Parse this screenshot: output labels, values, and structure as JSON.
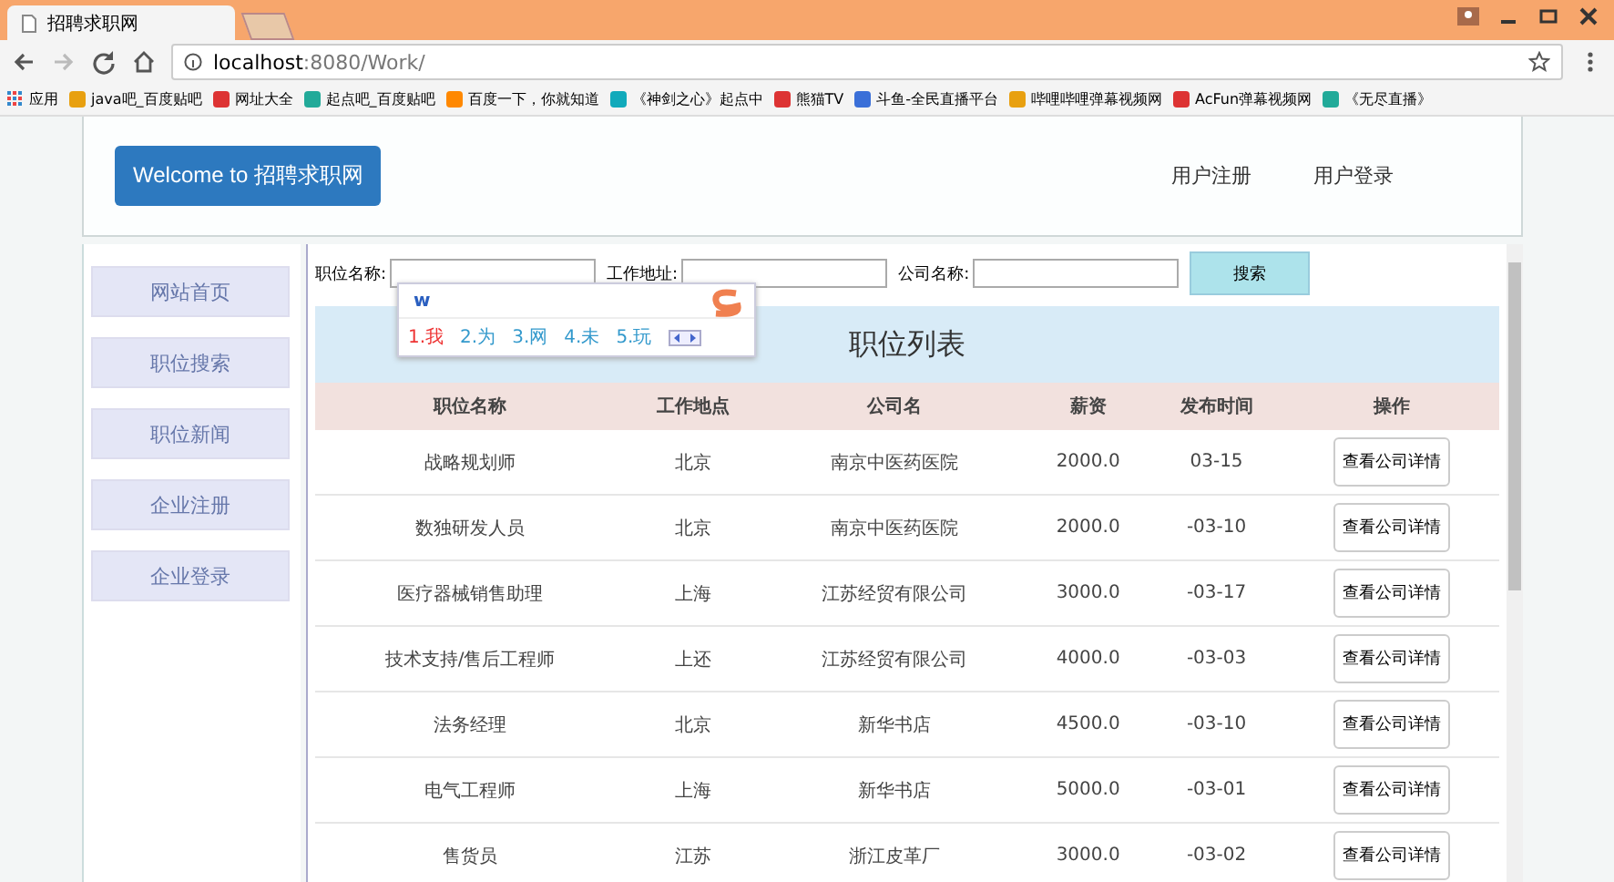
{
  "browser": {
    "tab_title": "招聘求职网",
    "url_host": "localhost",
    "url_rest": ":8080/Work/",
    "bookmarks": [
      "应用",
      "java吧_百度贴吧",
      "网址大全",
      "起点吧_百度贴吧",
      "百度一下，你就知道",
      "《神剑之心》起点中",
      "熊猫TV",
      "斗鱼-全民直播平台",
      "哔哩哔哩弹幕视频网",
      "AcFun弹幕视频网",
      "《无尽直播》"
    ]
  },
  "header": {
    "brand": "Welcome to 招聘求职网",
    "links": [
      "用户注册",
      "用户登录"
    ]
  },
  "sidebar": {
    "items": [
      {
        "label": "网站首页",
        "selected": false
      },
      {
        "label": "职位搜索",
        "selected": false
      },
      {
        "label": "职位新闻",
        "selected": false
      },
      {
        "label": "企业注册",
        "selected": false
      },
      {
        "label": "企业登录",
        "selected": false
      }
    ]
  },
  "search": {
    "fields": [
      {
        "label": "职位名称:"
      },
      {
        "label": "工作地址:"
      },
      {
        "label": "公司名称:"
      }
    ],
    "button": "搜索"
  },
  "ime": {
    "input": "w",
    "candidates": [
      "1.我",
      "2.为",
      "3.网",
      "4.未",
      "5.玩"
    ]
  },
  "table": {
    "title": "职位列表",
    "columns": [
      "职位名称",
      "工作地点",
      "公司名",
      "薪资",
      "发布时间",
      "操作"
    ],
    "rows": [
      {
        "cells": [
          "战略规划师",
          "北京",
          "南京中医药医院",
          "2000.0",
          "03-15"
        ],
        "action": "查看公司详情"
      },
      {
        "cells": [
          "数独研发人员",
          "北京",
          "南京中医药医院",
          "2000.0",
          "-03-10"
        ],
        "action": "查看公司详情"
      },
      {
        "cells": [
          "医疗器械销售助理",
          "上海",
          "江苏经贸有限公司",
          "3000.0",
          "-03-17"
        ],
        "action": "查看公司详情"
      },
      {
        "cells": [
          "技术支持/售后工程师",
          "上还",
          "江苏经贸有限公司",
          "4000.0",
          "-03-03"
        ],
        "action": "查看公司详情"
      },
      {
        "cells": [
          "法务经理",
          "北京",
          "新华书店",
          "4500.0",
          "-03-10"
        ],
        "action": "查看公司详情"
      },
      {
        "cells": [
          "电气工程师",
          "上海",
          "新华书店",
          "5000.0",
          "-03-01"
        ],
        "action": "查看公司详情"
      },
      {
        "cells": [
          "售货员",
          "江苏",
          "浙江皮革厂",
          "3000.0",
          "-03-02"
        ],
        "action": "查看公司详情"
      }
    ]
  }
}
